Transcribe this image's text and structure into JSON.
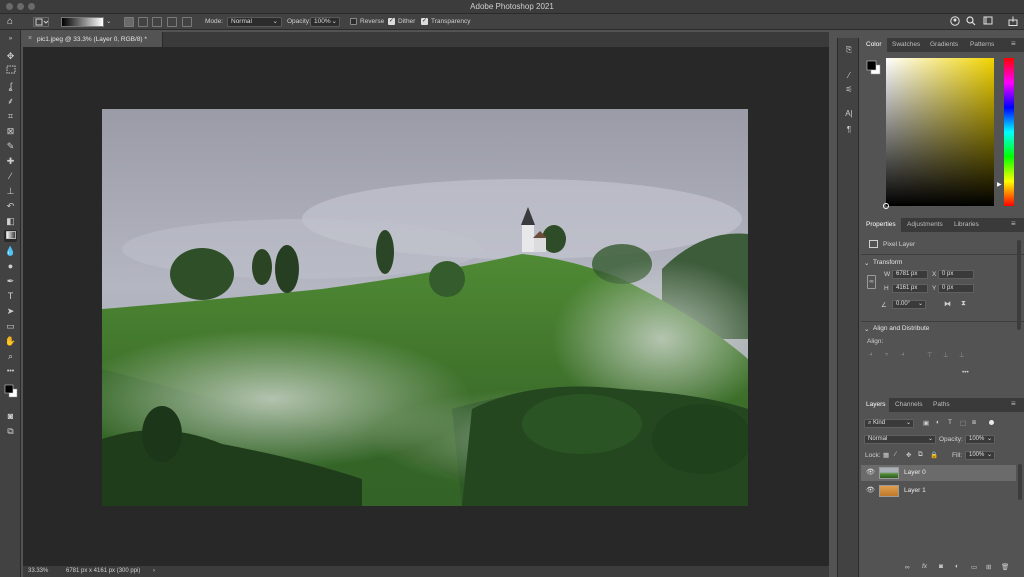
{
  "window": {
    "title": "Adobe Photoshop 2021"
  },
  "options_bar": {
    "mode_label": "Mode:",
    "mode_value": "Normal",
    "opacity_label": "Opacity:",
    "opacity_value": "100%",
    "reverse_label": "Reverse",
    "reverse_checked": false,
    "dither_label": "Dither",
    "dither_checked": true,
    "transparency_label": "Transparency",
    "transparency_checked": true
  },
  "document": {
    "tab_close": "×",
    "tab_title": "pic1.jpeg @ 33.3% (Layer 0, RGB/8) *"
  },
  "status_bar": {
    "zoom": "33.33%",
    "doc_info": "6781 px x 4161 px (300 ppi)",
    "arrow": "›"
  },
  "color_panel": {
    "tabs": [
      "Color",
      "Swatches",
      "Gradients",
      "Patterns"
    ],
    "active_tab": "Color",
    "hue_color": "#f2d400"
  },
  "properties_panel": {
    "tabs": [
      "Properties",
      "Adjustments",
      "Libraries"
    ],
    "active_tab": "Properties",
    "layer_type": "Pixel Layer",
    "transform_title": "Transform",
    "w_label": "W",
    "w_value": "6781 px",
    "h_label": "H",
    "h_value": "4161 px",
    "x_label": "X",
    "x_value": "0 px",
    "y_label": "Y",
    "y_value": "0 px",
    "angle_value": "0.00°",
    "align_title": "Align and Distribute",
    "align_label": "Align:",
    "more": "•••"
  },
  "layers_panel": {
    "tabs": [
      "Layers",
      "Channels",
      "Paths"
    ],
    "active_tab": "Layers",
    "kind_label": "Kind",
    "blend_mode": "Normal",
    "opacity_label": "Opacity:",
    "opacity_value": "100%",
    "lock_label": "Lock:",
    "fill_label": "Fill:",
    "fill_value": "100%",
    "layers": [
      {
        "name": "Layer 0",
        "selected": true
      },
      {
        "name": "Layer 1",
        "selected": false
      }
    ]
  }
}
